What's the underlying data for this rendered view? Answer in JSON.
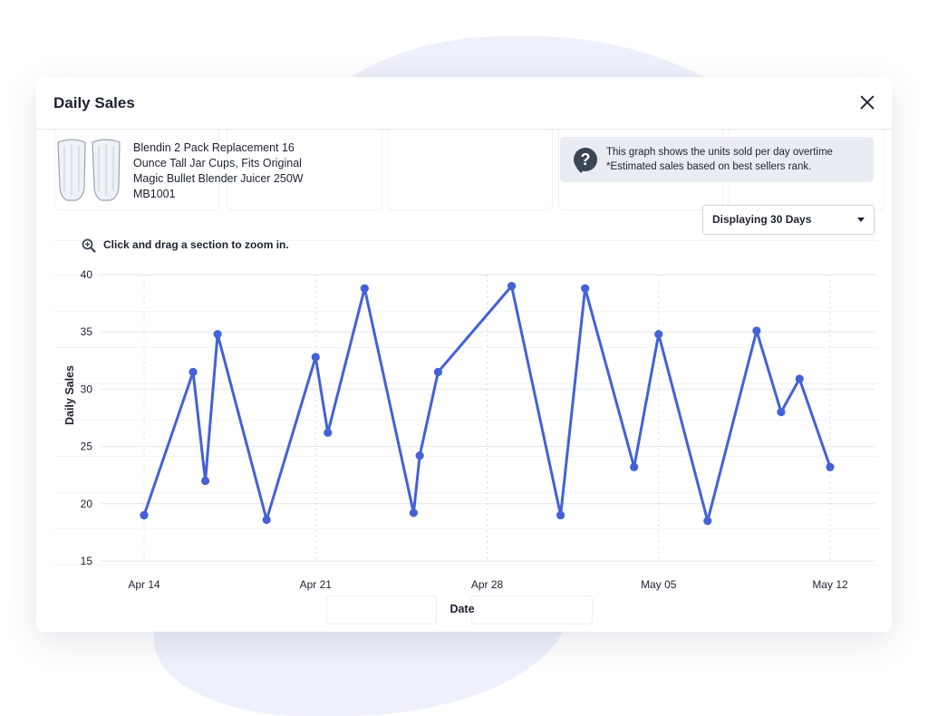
{
  "modal": {
    "title": "Daily Sales",
    "product": {
      "title": "Blendin 2 Pack Replacement 16 Ounce Tall Jar Cups, Fits Original Magic Bullet Blender Juicer 250W MB1001",
      "image_icon": "blender-cups-icon"
    },
    "info": {
      "icon": "question-mark-icon",
      "line1": "This graph shows the units sold per day overtime",
      "line2": "*Estimated sales based on best sellers rank."
    },
    "range_select": {
      "value": "Displaying 30 Days"
    },
    "zoom_hint": {
      "icon": "zoom-in-icon",
      "text": "Click and drag a section to zoom in."
    },
    "close_icon": "close-icon"
  },
  "colors": {
    "line": "#4361d8",
    "accent_bg": "#fdf3e7",
    "info_bg": "#e9ecf2"
  },
  "chart_data": {
    "type": "line",
    "xlabel": "Date",
    "ylabel": "Daily Sales",
    "ylim": [
      15,
      40
    ],
    "yticks": [
      15,
      20,
      25,
      30,
      35,
      40
    ],
    "xlim": [
      "2024-04-14",
      "2024-05-12"
    ],
    "xtick_labels": [
      "Apr 14",
      "Apr 21",
      "Apr 28",
      "May 05",
      "May 12"
    ],
    "grid": true,
    "series": [
      {
        "points": [
          {
            "x": "2024-04-14",
            "y": 19
          },
          {
            "x": "2024-04-16",
            "y": 31.5
          },
          {
            "x": "2024-04-16T12:00",
            "y": 22
          },
          {
            "x": "2024-04-17",
            "y": 34.8
          },
          {
            "x": "2024-04-19",
            "y": 18.6
          },
          {
            "x": "2024-04-21",
            "y": 32.8
          },
          {
            "x": "2024-04-21T12:00",
            "y": 26.2
          },
          {
            "x": "2024-04-23",
            "y": 38.8
          },
          {
            "x": "2024-04-25",
            "y": 19.2
          },
          {
            "x": "2024-04-25T06:00",
            "y": 24.2
          },
          {
            "x": "2024-04-26",
            "y": 31.5
          },
          {
            "x": "2024-04-29",
            "y": 39
          },
          {
            "x": "2024-05-01",
            "y": 19
          },
          {
            "x": "2024-05-02",
            "y": 38.8
          },
          {
            "x": "2024-05-04",
            "y": 23.2
          },
          {
            "x": "2024-05-05",
            "y": 34.8
          },
          {
            "x": "2024-05-07",
            "y": 18.5
          },
          {
            "x": "2024-05-09",
            "y": 35.1
          },
          {
            "x": "2024-05-10",
            "y": 28
          },
          {
            "x": "2024-05-10T18:00",
            "y": 30.9
          },
          {
            "x": "2024-05-12",
            "y": 23.2
          }
        ]
      }
    ]
  }
}
